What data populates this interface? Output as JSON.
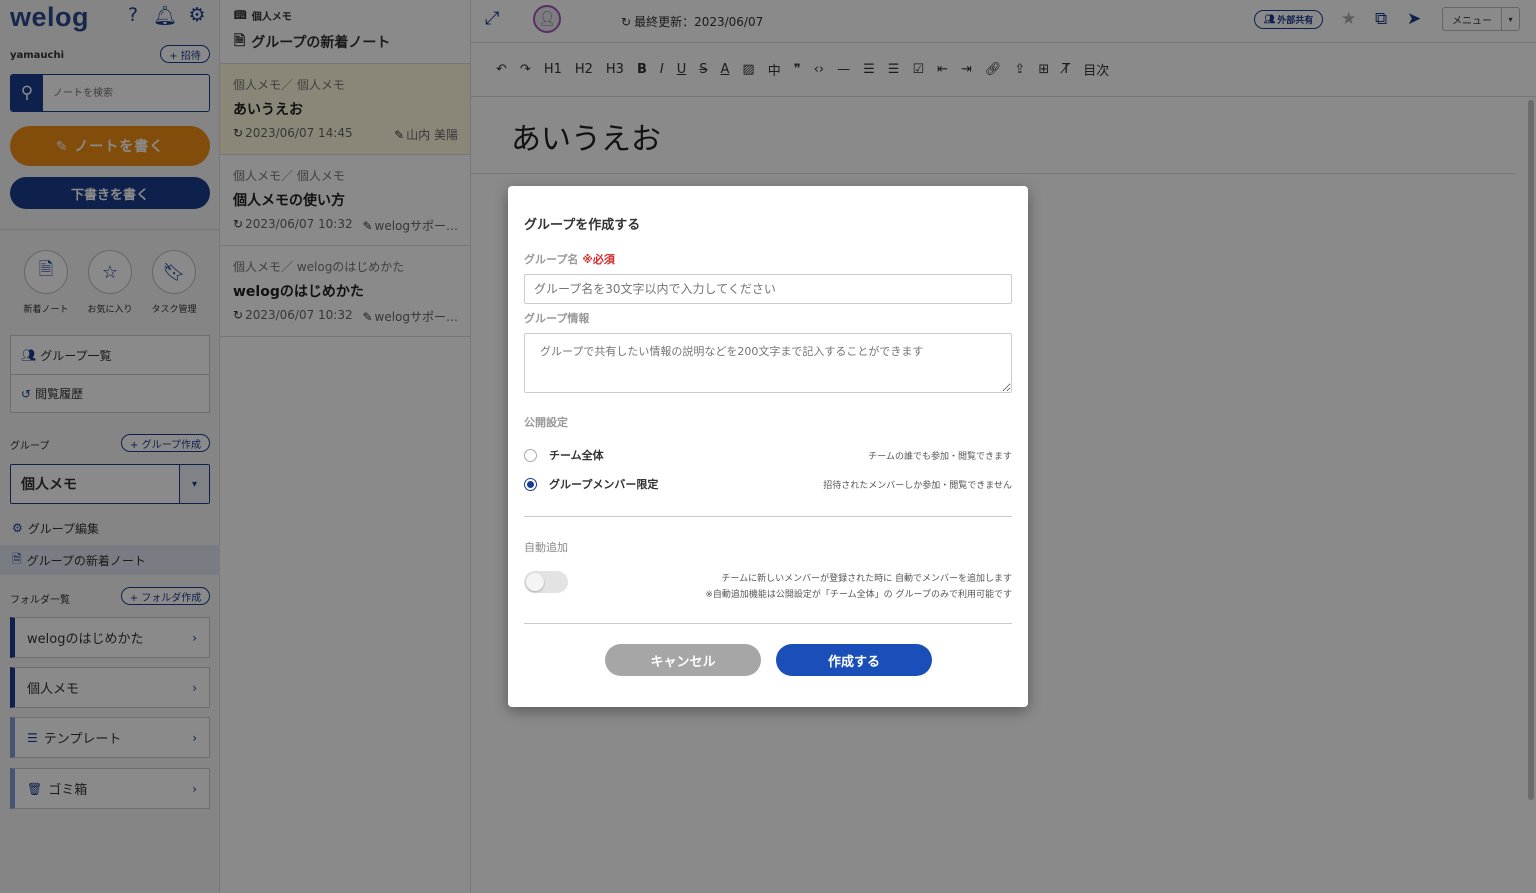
{
  "sidebar": {
    "logo": "welog",
    "username": "yamauchi",
    "invite_label": "+ 招待",
    "search_placeholder": "ノートを検索",
    "write_note": "✎ ノートを書く",
    "write_draft": "下書きを書く",
    "quick": [
      {
        "label": "新着ノート",
        "icon": "document-icon"
      },
      {
        "label": "お気に入り",
        "icon": "star-icon"
      },
      {
        "label": "タスク管理",
        "icon": "bookmark-icon"
      }
    ],
    "nav": [
      {
        "label": "グループ一覧",
        "icon": "group-icon"
      },
      {
        "label": "閲覧履歴",
        "icon": "history-icon"
      }
    ],
    "group_section": "グループ",
    "group_create": "+ グループ作成",
    "selected_group": "個人メモ",
    "group_edit": "グループ編集",
    "group_new_notes": "グループの新着ノート",
    "folder_section": "フォルダ一覧",
    "folder_create": "+ フォルダ作成",
    "folders": [
      "welogのはじめかた",
      "個人メモ",
      "テンプレート",
      "ゴミ箱"
    ]
  },
  "notelist": {
    "crumb": "個人メモ",
    "title": "グループの新着ノート",
    "notes": [
      {
        "path": "個人メモ／ 個人メモ",
        "title": "あいうえお",
        "date": "2023/06/07 14:45",
        "author": "山内 美陽"
      },
      {
        "path": "個人メモ／ 個人メモ",
        "title": "個人メモの使い方",
        "date": "2023/06/07 10:32",
        "author": "welogサポー…"
      },
      {
        "path": "個人メモ／ welogのはじめかた",
        "title": "welogのはじめかた",
        "date": "2023/06/07 10:32",
        "author": "welogサポー…"
      }
    ]
  },
  "editor": {
    "updated": "最終更新：2023/06/07",
    "external_share": "外部共有",
    "menu": "メニュー",
    "format": {
      "h1": "H1",
      "h2": "H2",
      "h3": "H3",
      "bold": "B",
      "italic": "I",
      "underline": "U",
      "strike": "S",
      "color": "A",
      "size": "中",
      "toc": "目次"
    },
    "doc_title": "あいうえお"
  },
  "modal": {
    "title": "グループを作成する",
    "name_label": "グループ名",
    "required": "※必須",
    "name_placeholder": "グループ名を30文字以内で入力してください",
    "info_label": "グループ情報",
    "info_placeholder": "グループで共有したい情報の説明などを200文字まで記入することができます",
    "visibility_label": "公開設定",
    "options": [
      {
        "label": "チーム全体",
        "desc": "チームの誰でも参加・閲覧できます",
        "checked": false
      },
      {
        "label": "グループメンバー限定",
        "desc": "招待されたメンバーしか参加・閲覧できません",
        "checked": true
      }
    ],
    "auto_label": "自動追加",
    "auto_enabled": false,
    "auto_desc1": "チームに新しいメンバーが登録された時に 自動でメンバーを追加します",
    "auto_desc2": "※自動追加機能は公開設定が「チーム全体」の グループのみで利用可能です",
    "cancel": "キャンセル",
    "create": "作成する"
  },
  "colors": {
    "primary": "#1a3d8f",
    "accent_orange": "#f08c14",
    "required_red": "#d42a2a",
    "create_button": "#1a4fba",
    "cancel_button": "#a6a6a6"
  }
}
